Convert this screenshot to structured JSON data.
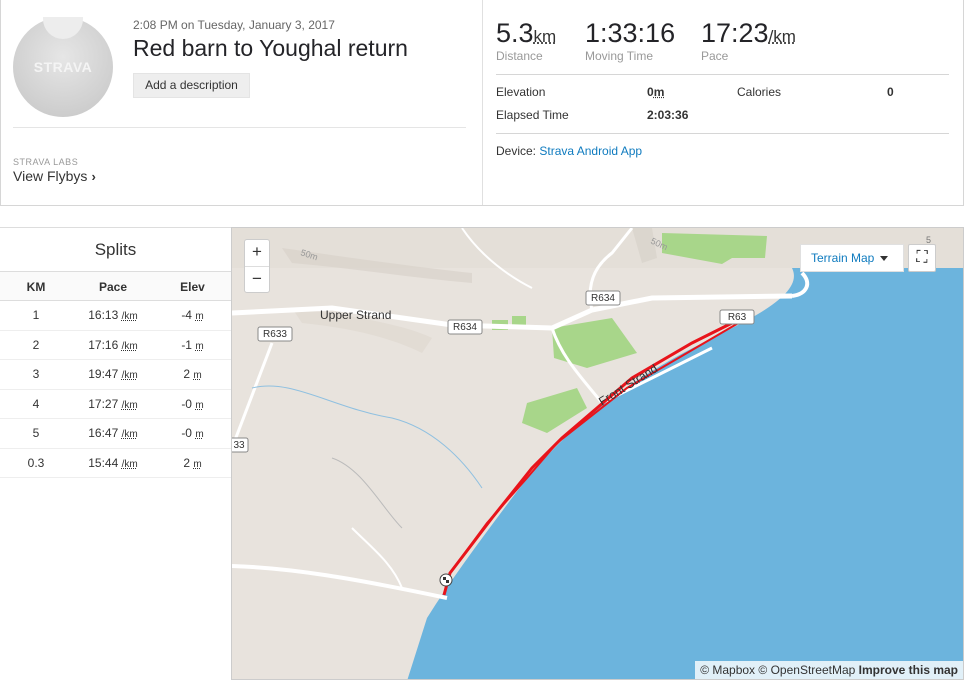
{
  "activity": {
    "date": "2:08 PM on Tuesday, January 3, 2017",
    "title": "Red barn to Youghal return",
    "add_description": "Add a description",
    "avatar_logo": "STRAVA"
  },
  "labs": {
    "heading": "STRAVA LABS",
    "flybys": "View Flybys",
    "chevron": "›"
  },
  "stats": {
    "distance": {
      "value": "5.3",
      "unit": "km",
      "label": "Distance"
    },
    "moving_time": {
      "value": "1:33:16",
      "label": "Moving Time"
    },
    "pace": {
      "value": "17:23",
      "unit": "/km",
      "label": "Pace"
    }
  },
  "details": {
    "elevation_label": "Elevation",
    "elevation_value": "0",
    "elevation_unit": "m",
    "calories_label": "Calories",
    "calories_value": "0",
    "elapsed_label": "Elapsed Time",
    "elapsed_value": "2:03:36",
    "device_label": "Device:",
    "device_value": "Strava Android App"
  },
  "splits": {
    "title": "Splits",
    "headers": [
      "KM",
      "Pace",
      "Elev"
    ],
    "rows": [
      {
        "km": "1",
        "pace": "16:13",
        "pace_unit": "/km",
        "elev": "-4",
        "elev_unit": "m"
      },
      {
        "km": "2",
        "pace": "17:16",
        "pace_unit": "/km",
        "elev": "-1",
        "elev_unit": "m"
      },
      {
        "km": "3",
        "pace": "19:47",
        "pace_unit": "/km",
        "elev": "2",
        "elev_unit": "m"
      },
      {
        "km": "4",
        "pace": "17:27",
        "pace_unit": "/km",
        "elev": "-0",
        "elev_unit": "m"
      },
      {
        "km": "5",
        "pace": "16:47",
        "pace_unit": "/km",
        "elev": "-0",
        "elev_unit": "m"
      },
      {
        "km": "0.3",
        "pace": "15:44",
        "pace_unit": "/km",
        "elev": "2",
        "elev_unit": "m"
      }
    ]
  },
  "map": {
    "zoom_in": "+",
    "zoom_out": "−",
    "style_select": "Terrain Map",
    "fullscreen_icon": "⛶",
    "attribution": {
      "mapbox": "© Mapbox",
      "osm": "© OpenStreetMap",
      "improve": "Improve this map"
    },
    "labels": {
      "upper_strand": "Upper Strand",
      "front_strand": "Front Strand",
      "r634_a": "R634",
      "r634_b": "R634",
      "r633": "R633",
      "r33": "33",
      "r6xx": "R63",
      "c50a": "50m",
      "c50b": "50m",
      "c5": "5"
    },
    "colors": {
      "land": "#e8e3dd",
      "sea": "#6cb4dd",
      "park": "#a8d68a",
      "route": "#e8141b"
    }
  }
}
